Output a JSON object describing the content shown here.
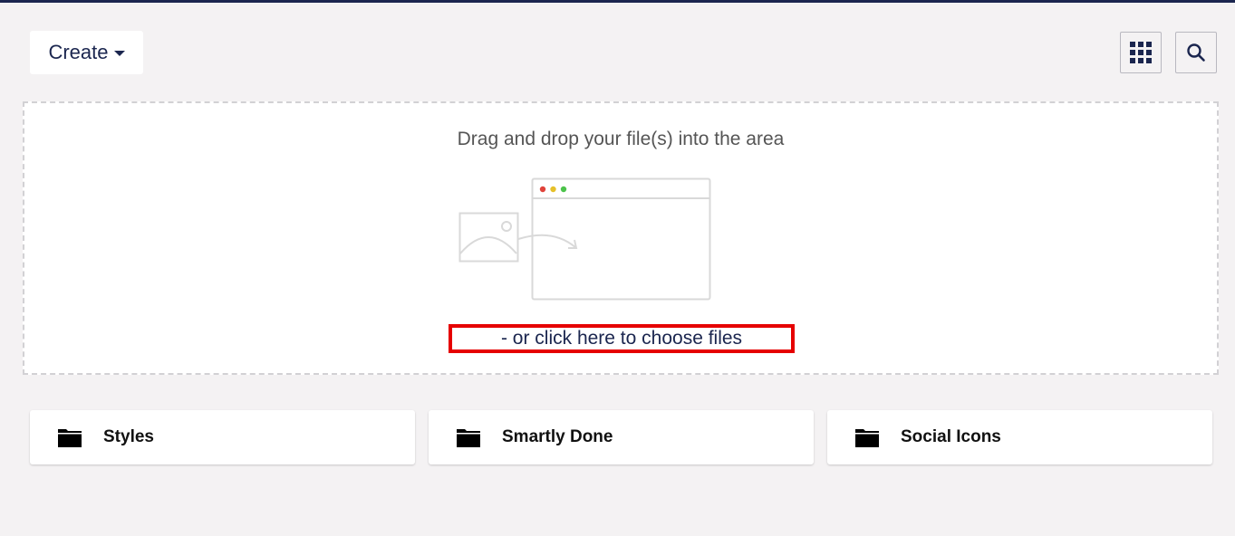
{
  "toolbar": {
    "create_label": "Create",
    "grid_icon": "grid-view-icon",
    "search_icon": "search-icon"
  },
  "dropzone": {
    "title": "Drag and drop your file(s) into the area",
    "choose_link": "- or click here to choose files",
    "highlight_color": "#e60000"
  },
  "folders": [
    {
      "name": "Styles",
      "icon": "folder-icon"
    },
    {
      "name": "Smartly Done",
      "icon": "folder-icon"
    },
    {
      "name": "Social Icons",
      "icon": "folder-icon"
    }
  ],
  "colors": {
    "primary": "#1b264f",
    "background": "#f4f2f3"
  }
}
